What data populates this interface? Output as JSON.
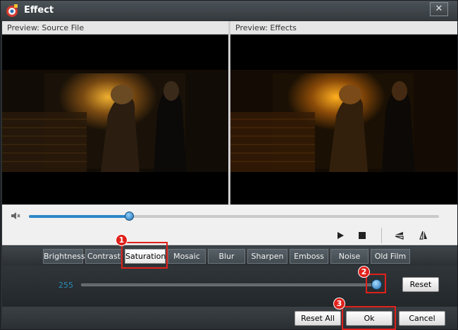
{
  "window": {
    "title": "Effect",
    "close_glyph": "✕"
  },
  "preview": {
    "source_label": "Preview: Source File",
    "effects_label": "Preview: Effects"
  },
  "playback": {
    "seek_progress": 0.245,
    "icons": [
      "volume-icon",
      "play-icon",
      "stop-icon",
      "flip-vertical-icon",
      "flip-horizontal-icon"
    ]
  },
  "tabs": [
    {
      "label": "Brightness",
      "active": false
    },
    {
      "label": "Contrast",
      "active": false
    },
    {
      "label": "Saturation",
      "active": true
    },
    {
      "label": "Mosaic",
      "active": false
    },
    {
      "label": "Blur",
      "active": false
    },
    {
      "label": "Sharpen",
      "active": false
    },
    {
      "label": "Emboss",
      "active": false
    },
    {
      "label": "Noise",
      "active": false
    },
    {
      "label": "Old Film",
      "active": false
    }
  ],
  "adjust": {
    "value": "255",
    "slider_position": 1.0,
    "reset_label": "Reset"
  },
  "footer": {
    "reset_all_label": "Reset All",
    "ok_label": "Ok",
    "cancel_label": "Cancel"
  },
  "annotations": [
    "1",
    "2",
    "3"
  ],
  "colors": {
    "accent": "#2d86c8",
    "highlight": "#e0201b",
    "value_text": "#2a8cb8"
  }
}
